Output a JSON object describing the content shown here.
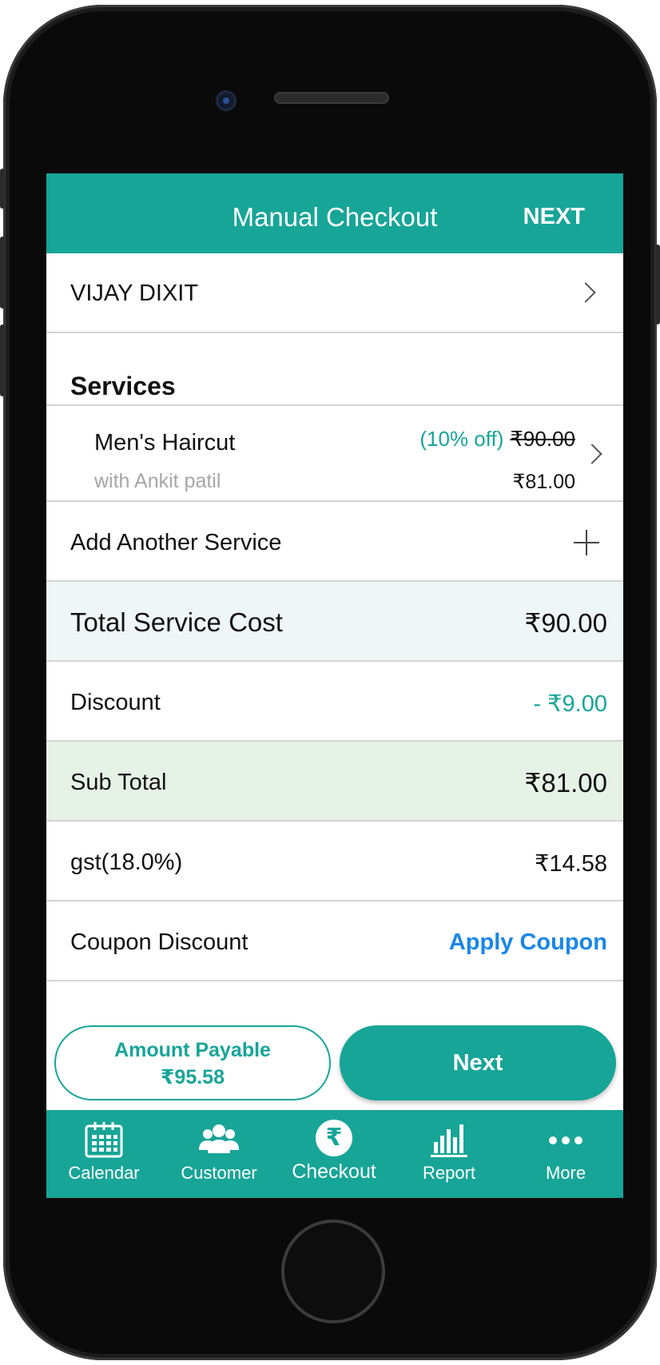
{
  "header": {
    "title": "Manual Checkout",
    "next_label": "NEXT"
  },
  "customer": {
    "name": "VIJAY DIXIT"
  },
  "services": {
    "heading": "Services",
    "items": [
      {
        "name": "Men's Haircut",
        "staff": "with Ankit patil",
        "discount_label": "(10% off)",
        "original_price": "₹90.00",
        "final_price": "₹81.00"
      }
    ],
    "add_label": "Add Another Service"
  },
  "summary": {
    "total_label": "Total Service Cost",
    "total_value": "₹90.00",
    "discount_label": "Discount",
    "discount_value": "- ₹9.00",
    "subtotal_label": "Sub Total",
    "subtotal_value": "₹81.00",
    "gst_label": "gst(18.0%)",
    "gst_value": "₹14.58",
    "coupon_label": "Coupon Discount",
    "coupon_action": "Apply Coupon"
  },
  "footer": {
    "amount_label": "Amount Payable",
    "amount_value": "₹95.58",
    "next_button": "Next"
  },
  "tabs": [
    {
      "label": "Calendar",
      "icon": "calendar-icon"
    },
    {
      "label": "Customer",
      "icon": "customers-icon"
    },
    {
      "label": "Checkout",
      "icon": "rupee-icon",
      "active": true
    },
    {
      "label": "Report",
      "icon": "bar-chart-icon"
    },
    {
      "label": "More",
      "icon": "more-dots-icon"
    }
  ],
  "icons": {
    "checkout_symbol": "₹"
  },
  "colors": {
    "primary": "#17a597",
    "link": "#1a86e8",
    "total_bg": "#eff6f6",
    "subtotal_bg": "#e7f2e6",
    "muted_text": "#a6a6a6"
  }
}
